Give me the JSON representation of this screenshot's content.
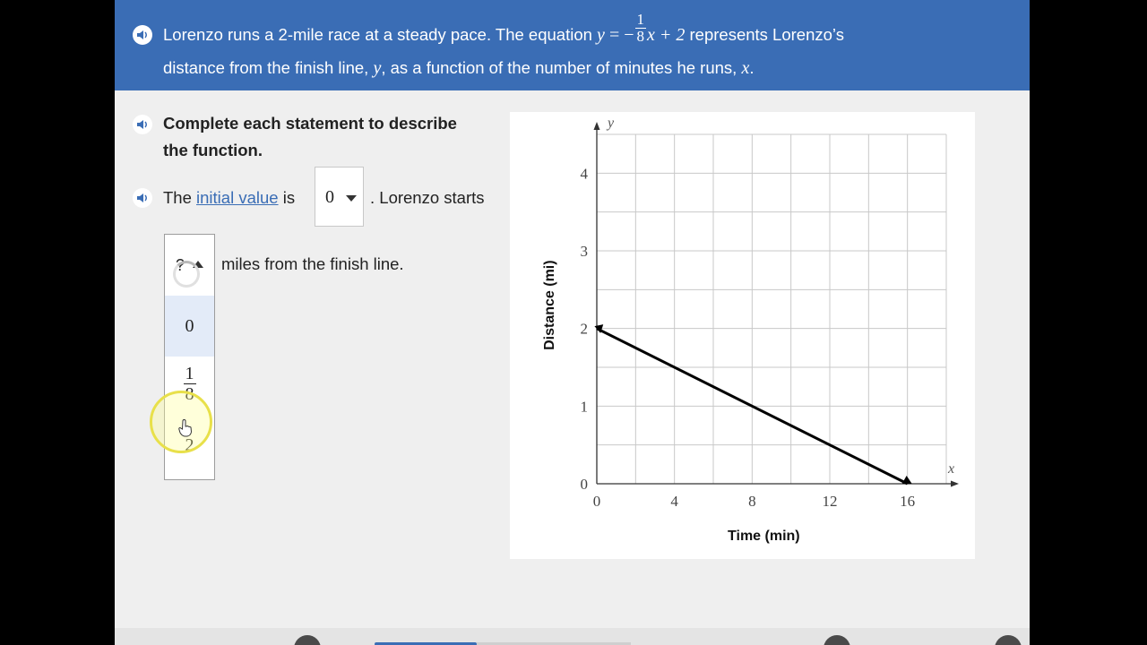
{
  "question": {
    "prompt_part1": "Lorenzo runs a 2-mile race at a steady pace. The equation",
    "eq_lhs": "y",
    "eq_sign": " = −",
    "eq_frac_num": "1",
    "eq_frac_den": "8",
    "eq_rest": "x + 2",
    "prompt_part2": "represents Lorenzo’s",
    "line2_part1": "distance from the finish line,",
    "line2_y": "y",
    "line2_part2": ", as a function of the number of minutes he runs,",
    "line2_x": "x",
    "line2_end": "."
  },
  "instructions": {
    "line1": "Complete each statement to describe",
    "line2": "the function."
  },
  "statement1": {
    "pre": "The",
    "link": "initial value",
    "mid": "is",
    "selected": "0",
    "post": ". Lorenzo starts"
  },
  "statement2": {
    "selected": "?",
    "post": "miles from the finish line.",
    "options": [
      "0",
      "1/8",
      "2"
    ],
    "option_frac_num": "1",
    "option_frac_den": "8"
  },
  "chart_data": {
    "type": "line",
    "xlabel": "Time (min)",
    "ylabel": "Distance (mi)",
    "x_axis_letter": "x",
    "y_axis_letter": "y",
    "xlim": [
      0,
      18
    ],
    "ylim": [
      0,
      4.5
    ],
    "x_ticks": [
      0,
      4,
      8,
      12,
      16
    ],
    "y_ticks": [
      0,
      1,
      2,
      3,
      4
    ],
    "grid": true,
    "series": [
      {
        "points": [
          [
            0,
            2
          ],
          [
            16,
            0
          ]
        ]
      }
    ]
  },
  "colors": {
    "header_bg": "#3a6db5",
    "link": "#3a6db5",
    "option_highlight": "#e3ebf8",
    "line": "#000000"
  },
  "icons": [
    "speaker-icon",
    "caret-down-icon",
    "caret-up-icon",
    "loading-spinner-icon",
    "hand-cursor-icon"
  ]
}
